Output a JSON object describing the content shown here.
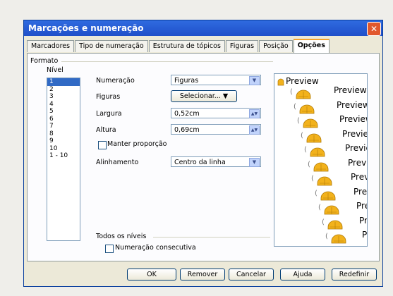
{
  "dialog": {
    "title": "Marcações e numeração",
    "close_glyph": "✕"
  },
  "tabs": [
    {
      "label": "Marcadores"
    },
    {
      "label": "Tipo de numeração"
    },
    {
      "label": "Estrutura de tópicos"
    },
    {
      "label": "Figuras"
    },
    {
      "label": "Posição"
    },
    {
      "label": "Opções"
    }
  ],
  "active_tab": "Opções",
  "format": {
    "group_label": "Formato",
    "level_label": "Nível",
    "levels": [
      "1",
      "2",
      "3",
      "4",
      "5",
      "6",
      "7",
      "8",
      "9",
      "10",
      "1 - 10"
    ],
    "selected_level": "1",
    "numeracao_label": "Numeração",
    "numeracao_value": "Figuras",
    "figuras_label": "Figuras",
    "figuras_button": "Selecionar... ▼",
    "largura_label": "Largura",
    "largura_value": "0,52cm",
    "altura_label": "Altura",
    "altura_value": "0,69cm",
    "manter_label": "Manter proporção",
    "alinhamento_label": "Alinhamento",
    "alinhamento_value": "Centro da linha"
  },
  "preview": {
    "title": "Preview",
    "item_text": "Preview",
    "item_count": 11
  },
  "all_levels": {
    "group_label": "Todos os níveis",
    "consecutive_label": "Numeração consecutiva"
  },
  "buttons": {
    "ok": "OK",
    "remove": "Remover",
    "cancel": "Cancelar",
    "help": "Ajuda",
    "reset": "Redefinir"
  },
  "colors": {
    "title_bar": "#2459d6",
    "selection": "#316ac5",
    "bullet_fill": "#f2b21c"
  }
}
